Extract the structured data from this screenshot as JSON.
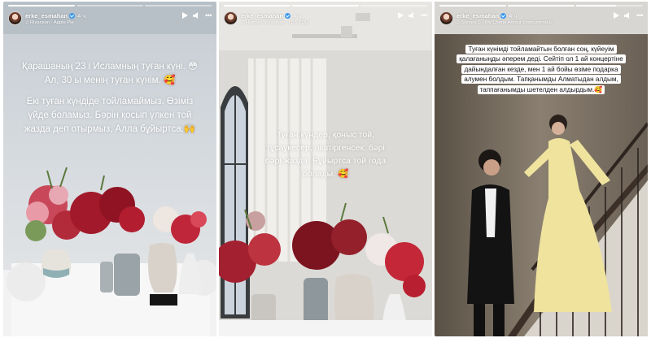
{
  "stories": [
    {
      "username": "erke_esmahan",
      "time": "4 ч.",
      "music": "Riyanson · Apple Pie",
      "caption_lines": [
        "Қарашаның 23 і Исламның туған күні. 😳",
        "Ал, 30 ы менің туған күнім. 🥰"
      ],
      "caption2_lines": [
        "Екі туған күндіде тойламаймыз. Өзіміз",
        "үйде боламыз. Бәрін қосып үлкен той",
        "жазда деп отырмыз, Алла бұйыртса.🙌"
      ],
      "progress": [
        1,
        0,
        0
      ]
    },
    {
      "username": "erke_esmahan",
      "time": "4 ч.",
      "music": "Harryan Yoonsoan · IT'S YOU",
      "caption_lines": [
        "Туған күндер, қоныс той,",
        "тұсаукесер, піштіргенсек, бәрі",
        "бәрі жазда. Бұйыртса той годa",
        "болады. 🥰"
      ],
      "progress": [
        1,
        1,
        0
      ]
    },
    {
      "username": "erke_esmahan",
      "time": "4 ч.",
      "music": "Steven C · My Cherie Amour (instrumental)",
      "caption_lines": [
        "Туған күнімді тойламайтын болған соң, күйеуім",
        "қалағаныңды әперем деді. Сейтіп ол 1 ай концертіне",
        "дайындалған кезде, мен 1 ай бойы өзіме подарка",
        "алумен болдым. Тапқанымды Алматыдан алдым,",
        "таппағанымды шетелден алдырдым.🥰"
      ],
      "progress": [
        1,
        1,
        0.6
      ]
    }
  ]
}
